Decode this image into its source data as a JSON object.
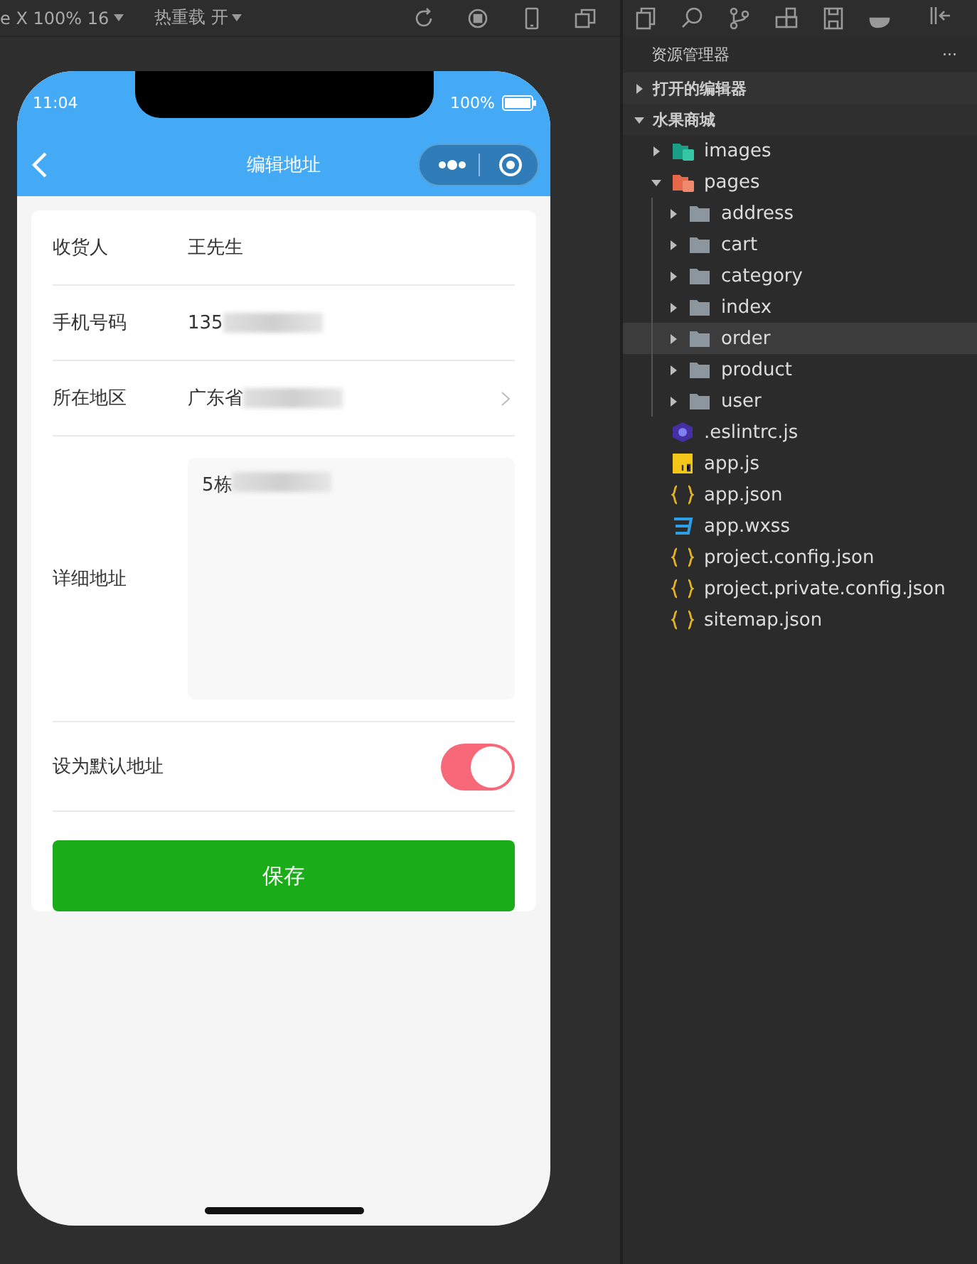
{
  "toolbar": {
    "device": "e X 100% 16",
    "hot_reload": "热重载 开"
  },
  "phone": {
    "status_bar": {
      "time": "11:04",
      "battery": "100%"
    },
    "nav": {
      "title": "编辑地址"
    },
    "form": [
      {
        "kind": "text",
        "label": "收货人",
        "value": "王先生",
        "blurred": false
      },
      {
        "kind": "text",
        "label": "手机号码",
        "value": "135",
        "blurred": true
      },
      {
        "kind": "picker",
        "label": "所在地区",
        "value": "广东省",
        "blurred": true
      },
      {
        "kind": "textarea",
        "label": "详细地址",
        "value": "5栋",
        "blurred": true
      },
      {
        "kind": "switch",
        "label": "设为默认地址",
        "on": true
      }
    ],
    "save_button": "保存"
  },
  "explorer": {
    "title": "资源管理器",
    "more": "···",
    "sections": [
      {
        "label": "打开的编辑器",
        "expanded": false
      },
      {
        "label": "水果商城",
        "expanded": true,
        "children": [
          {
            "kind": "image-folder",
            "name": "images",
            "expanded": false,
            "selected": false
          },
          {
            "kind": "pages-folder",
            "name": "pages",
            "expanded": true,
            "selected": false,
            "children": [
              {
                "kind": "folder",
                "name": "address",
                "expanded": false,
                "selected": false
              },
              {
                "kind": "folder",
                "name": "cart",
                "expanded": false,
                "selected": false
              },
              {
                "kind": "folder",
                "name": "category",
                "expanded": false,
                "selected": false
              },
              {
                "kind": "folder",
                "name": "index",
                "expanded": false,
                "selected": false
              },
              {
                "kind": "folder",
                "name": "order",
                "expanded": false,
                "selected": true
              },
              {
                "kind": "folder",
                "name": "product",
                "expanded": false,
                "selected": false
              },
              {
                "kind": "folder",
                "name": "user",
                "expanded": false,
                "selected": false
              }
            ]
          },
          {
            "kind": "eslint",
            "name": ".eslintrc.js",
            "selected": false
          },
          {
            "kind": "js",
            "name": "app.js",
            "selected": false
          },
          {
            "kind": "json",
            "name": "app.json",
            "selected": false
          },
          {
            "kind": "css",
            "name": "app.wxss",
            "selected": false
          },
          {
            "kind": "json",
            "name": "project.config.json",
            "selected": false
          },
          {
            "kind": "json",
            "name": "project.private.config.json",
            "selected": false
          },
          {
            "kind": "json",
            "name": "sitemap.json",
            "selected": false
          }
        ]
      }
    ]
  }
}
